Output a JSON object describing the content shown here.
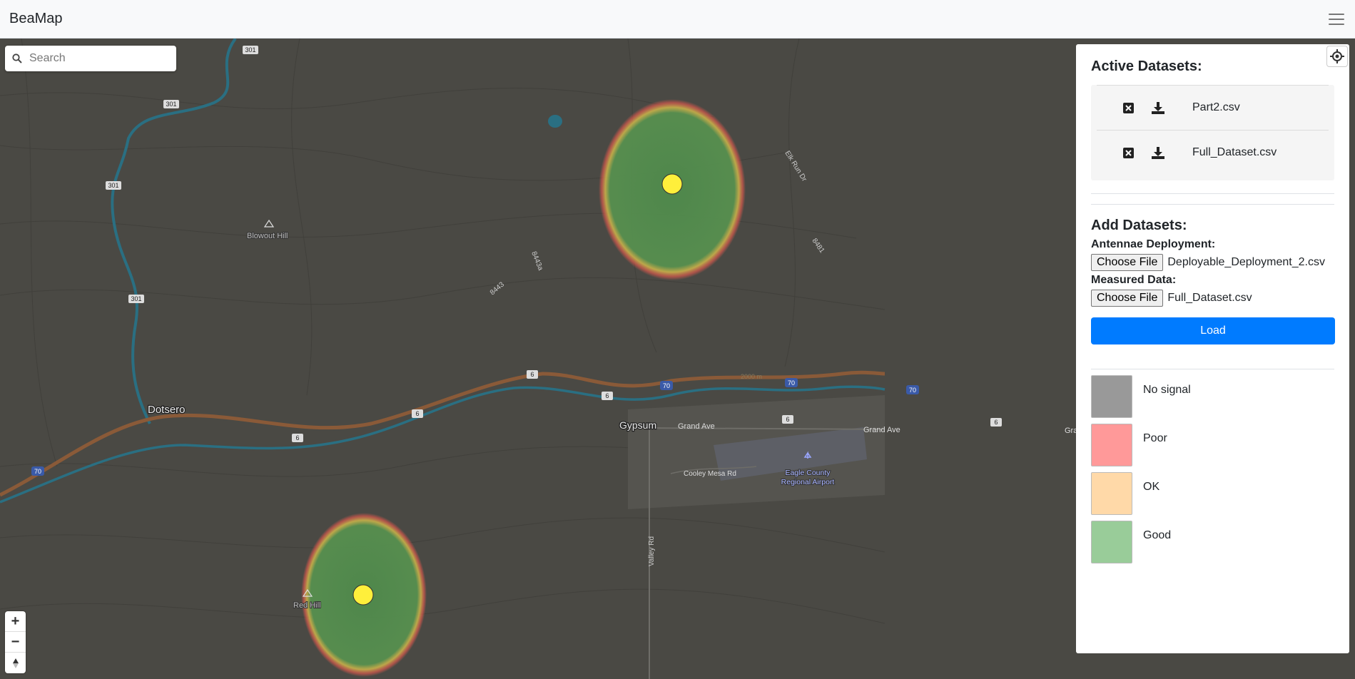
{
  "app": {
    "brand": "BeaMap"
  },
  "search": {
    "placeholder": "Search"
  },
  "map": {
    "labels": {
      "dotsero": "Dotsero",
      "gypsum": "Gypsum",
      "blowout_hill": "Blowout Hill",
      "red_hill": "Red Hill",
      "grand_ave_1": "Grand Ave",
      "grand_ave_2": "Grand Ave",
      "grand_ave_3": "Gra",
      "cooley_mesa": "Cooley Mesa Rd",
      "airport_line1": "Eagle County",
      "airport_line2": "Regional Airport",
      "valley_rd": "Valley Rd",
      "elk_run": "Elk Run Dr",
      "r8443a": "8443a",
      "r8443": "8443",
      "r8481": "8481",
      "elev": "2000 m"
    },
    "shields": {
      "s301a": "301",
      "s301b": "301",
      "s301c": "301",
      "s301d": "301",
      "s6a": "6",
      "s6b": "6",
      "s6c": "6",
      "s6d": "6",
      "s6e": "6",
      "s6f": "6",
      "s70a": "70",
      "s70b": "70",
      "s70c": "70",
      "s70d": "70"
    },
    "zoom": {
      "in": "+",
      "out": "−"
    }
  },
  "panel": {
    "active_title": "Active Datasets:",
    "datasets": [
      {
        "name": "Part2.csv"
      },
      {
        "name": "Full_Dataset.csv"
      }
    ],
    "add_title": "Add Datasets:",
    "antennae_label": "Antennae Deployment:",
    "antennae_button": "Choose File",
    "antennae_file": "Deployable_Deployment_2.csv",
    "measured_label": "Measured Data:",
    "measured_button": "Choose File",
    "measured_file": "Full_Dataset.csv",
    "load_label": "Load",
    "legend": [
      {
        "label": "No signal",
        "color": "#999999"
      },
      {
        "label": "Poor",
        "color": "#ff9999"
      },
      {
        "label": "OK",
        "color": "#ffd9a8"
      },
      {
        "label": "Good",
        "color": "#99cc99"
      }
    ]
  }
}
